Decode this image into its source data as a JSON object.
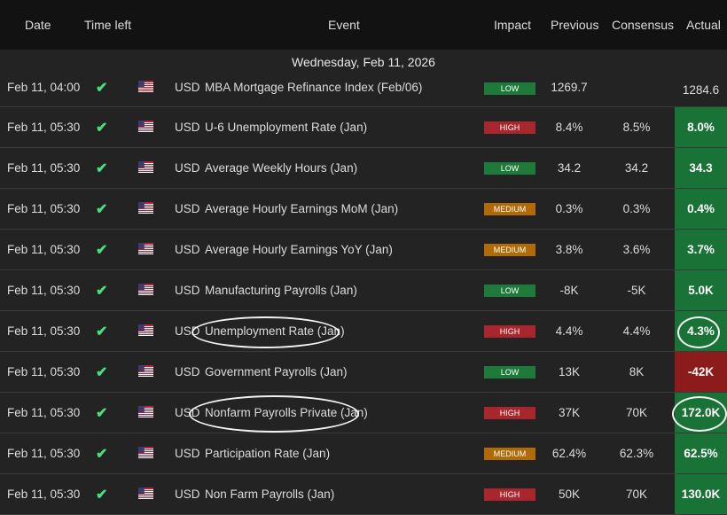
{
  "header": {
    "date": "Date",
    "time_left": "Time left",
    "event": "Event",
    "impact": "Impact",
    "previous": "Previous",
    "consensus": "Consensus",
    "actual": "Actual"
  },
  "date_banner": "Wednesday, Feb 11, 2026",
  "colors": {
    "low": "#1e7a3a",
    "high": "#a8262e",
    "medium": "#b06a06",
    "actual_positive": "#1a7336",
    "actual_negative": "#8c1c1c"
  },
  "rows": [
    {
      "date": "Feb 11, 04:00",
      "status": "check-icon",
      "flag": "us-flag-icon",
      "currency": "USD",
      "event": "MBA Mortgage Refinance Index (Feb/06)",
      "impact": "LOW",
      "previous": "1269.7",
      "consensus": "",
      "actual": "1284.6",
      "actual_tone": "none"
    },
    {
      "date": "Feb 11, 05:30",
      "status": "check-icon",
      "flag": "us-flag-icon",
      "currency": "USD",
      "event": "U-6 Unemployment Rate (Jan)",
      "impact": "HIGH",
      "previous": "8.4%",
      "consensus": "8.5%",
      "actual": "8.0%",
      "actual_tone": "green"
    },
    {
      "date": "Feb 11, 05:30",
      "status": "check-icon",
      "flag": "us-flag-icon",
      "currency": "USD",
      "event": "Average Weekly Hours (Jan)",
      "impact": "LOW",
      "previous": "34.2",
      "consensus": "34.2",
      "actual": "34.3",
      "actual_tone": "green"
    },
    {
      "date": "Feb 11, 05:30",
      "status": "check-icon",
      "flag": "us-flag-icon",
      "currency": "USD",
      "event": "Average Hourly Earnings MoM (Jan)",
      "impact": "MEDIUM",
      "previous": "0.3%",
      "consensus": "0.3%",
      "actual": "0.4%",
      "actual_tone": "green"
    },
    {
      "date": "Feb 11, 05:30",
      "status": "check-icon",
      "flag": "us-flag-icon",
      "currency": "USD",
      "event": "Average Hourly Earnings YoY (Jan)",
      "impact": "MEDIUM",
      "previous": "3.8%",
      "consensus": "3.6%",
      "actual": "3.7%",
      "actual_tone": "green"
    },
    {
      "date": "Feb 11, 05:30",
      "status": "check-icon",
      "flag": "us-flag-icon",
      "currency": "USD",
      "event": "Manufacturing Payrolls (Jan)",
      "impact": "LOW",
      "previous": "-8K",
      "consensus": "-5K",
      "actual": "5.0K",
      "actual_tone": "green"
    },
    {
      "date": "Feb 11, 05:30",
      "status": "check-icon",
      "flag": "us-flag-icon",
      "currency": "USD",
      "event": "Unemployment Rate (Jan)",
      "impact": "HIGH",
      "previous": "4.4%",
      "consensus": "4.4%",
      "actual": "4.3%",
      "actual_tone": "green"
    },
    {
      "date": "Feb 11, 05:30",
      "status": "check-icon",
      "flag": "us-flag-icon",
      "currency": "USD",
      "event": "Government Payrolls (Jan)",
      "impact": "LOW",
      "previous": "13K",
      "consensus": "8K",
      "actual": "-42K",
      "actual_tone": "red"
    },
    {
      "date": "Feb 11, 05:30",
      "status": "check-icon",
      "flag": "us-flag-icon",
      "currency": "USD",
      "event": "Nonfarm Payrolls Private (Jan)",
      "impact": "HIGH",
      "previous": "37K",
      "consensus": "70K",
      "actual": "172.0K",
      "actual_tone": "green"
    },
    {
      "date": "Feb 11, 05:30",
      "status": "check-icon",
      "flag": "us-flag-icon",
      "currency": "USD",
      "event": "Participation Rate (Jan)",
      "impact": "MEDIUM",
      "previous": "62.4%",
      "consensus": "62.3%",
      "actual": "62.5%",
      "actual_tone": "green"
    },
    {
      "date": "Feb 11, 05:30",
      "status": "check-icon",
      "flag": "us-flag-icon",
      "currency": "USD",
      "event": "Non Farm Payrolls (Jan)",
      "impact": "HIGH",
      "previous": "50K",
      "consensus": "70K",
      "actual": "130.0K",
      "actual_tone": "green"
    }
  ]
}
